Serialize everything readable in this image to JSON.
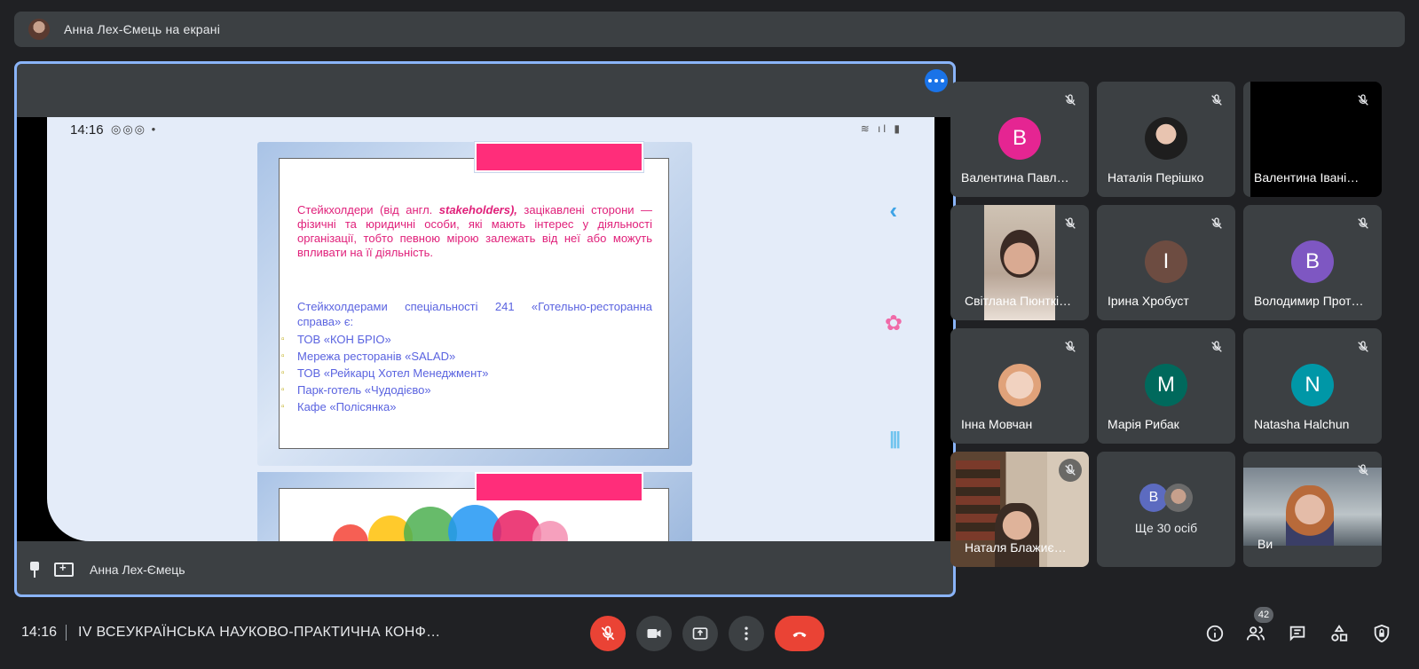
{
  "banner": {
    "text": "Анна Лех-Ємець на екрані"
  },
  "main": {
    "presenter_name": "Анна Лех-Ємець",
    "phone_time": "14:16",
    "phone_notif_icons": "◎◎◎ •",
    "phone_sys_icons": "≋ ıl ▮",
    "slide": {
      "para1_pre": "Стейкхолдери (від англ. ",
      "para1_em": "stakeholders),",
      "para1_post": " зацікавлені сторони — фізичні та юридичні особи, які мають інтерес у діяльності організації, тобто певною мірою залежать від неї або можуть впливати на її діяльність.",
      "para2": "Стейкхолдерами спеціальності 241 «Готельно-ресторанна справа» є:",
      "items": [
        "ТОВ «КОН БРІО»",
        "Мережа ресторанів «SALAD»",
        "ТОВ «Рейкарц Хотел Менеджмент»",
        "Парк-готель «Чудодієво»",
        "Кафе «Полісянка»"
      ]
    },
    "side_chevron": "‹",
    "side_flower": "✿",
    "side_bars": "|||"
  },
  "participants": [
    {
      "name": "Валентина Павл…",
      "initial": "В",
      "color": "#e52592"
    },
    {
      "name": "Наталія Перішко",
      "initial": "",
      "color": "#5f6368"
    },
    {
      "name": "Валентина Івані…",
      "initial": "",
      "color": "#000000"
    },
    {
      "name": "Світлана Пюнткі…",
      "initial": "",
      "color": "#d8c6b8"
    },
    {
      "name": "Ірина Хробуст",
      "initial": "І",
      "color": "#6d4c41"
    },
    {
      "name": "Володимир Прот…",
      "initial": "В",
      "color": "#7e57c2"
    },
    {
      "name": "Інна Мовчан",
      "initial": "",
      "color": "#e0c4b0"
    },
    {
      "name": "Марія Рибак",
      "initial": "М",
      "color": "#00695c"
    },
    {
      "name": "Natasha Halchun",
      "initial": "N",
      "color": "#0097a7"
    },
    {
      "name": "Наталя Блажиє…",
      "initial": "",
      "color": "#8d6e55"
    },
    {
      "name": "Ви",
      "initial": "",
      "color": "#a8b0b8"
    }
  ],
  "more": {
    "text": "Ще 30 осіб",
    "initial": "В"
  },
  "bottom": {
    "time": "14:16",
    "meeting_title": "IV ВСЕУКРАЇНСЬКА НАУКОВО-ПРАКТИЧНА КОНФ…",
    "people_count": "42"
  }
}
